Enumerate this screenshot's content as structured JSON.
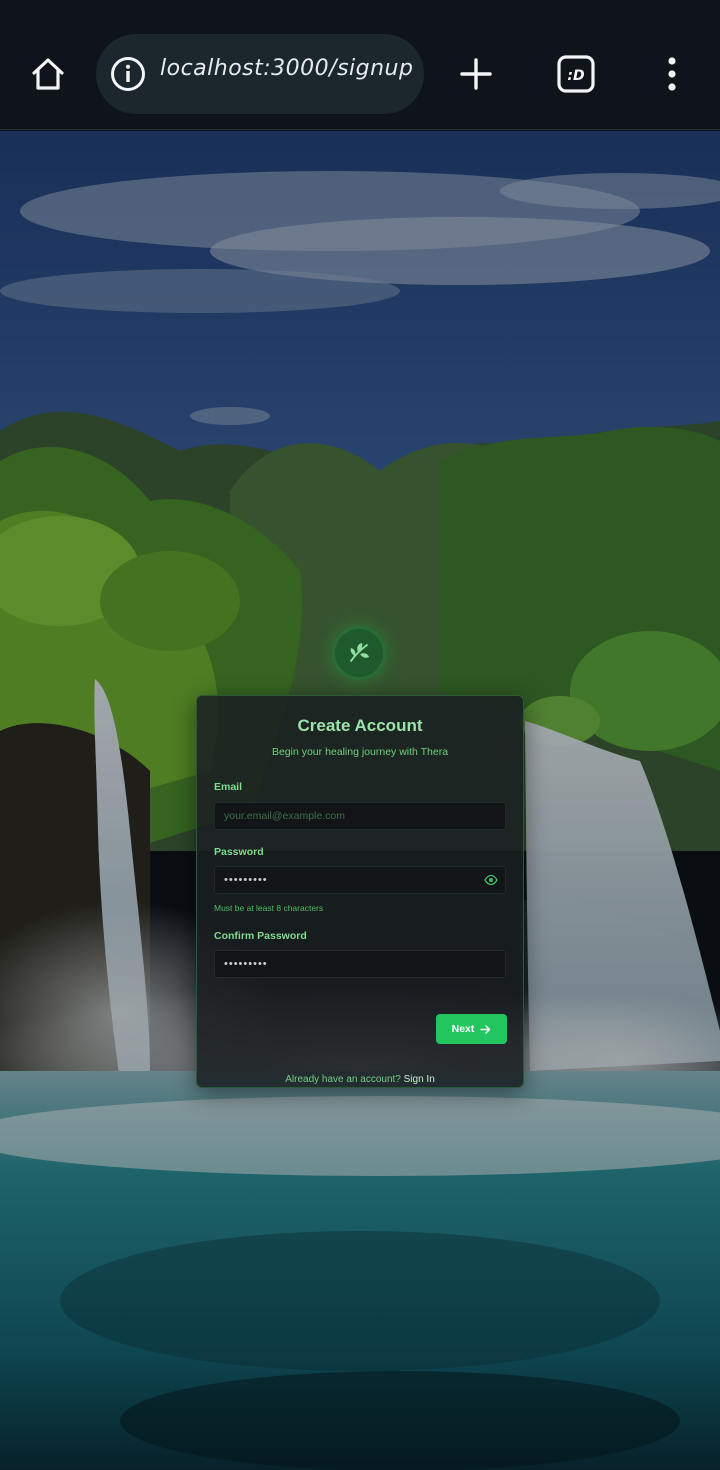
{
  "browser": {
    "url": "localhost:3000/signup"
  },
  "form": {
    "title": "Create Account",
    "subtitle": "Begin your healing journey with Thera",
    "email": {
      "label": "Email",
      "placeholder": "your.email@example.com",
      "value": ""
    },
    "password": {
      "label": "Password",
      "value": "•••••••••",
      "hint": "Must be at least 8 characters"
    },
    "confirm_password": {
      "label": "Confirm Password",
      "value": "•••••••••"
    },
    "next_label": "Next",
    "footer_text": "Already have an account?",
    "signin_label": "Sign In"
  },
  "colors": {
    "accent": "#22c55e",
    "title": "#9be3a8",
    "chrome_bg": "#0f141b",
    "address_bg": "#1b272d"
  },
  "icons": [
    "home-icon",
    "info-icon",
    "plus-icon",
    "tabs-icon",
    "more-vert-icon",
    "leaf-icon",
    "eye-icon",
    "arrow-right-icon"
  ]
}
